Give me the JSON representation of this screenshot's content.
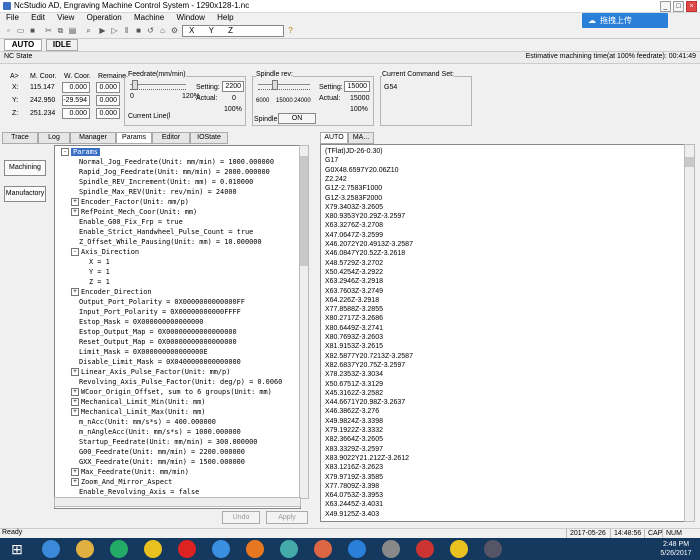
{
  "window": {
    "title": "NcStudio AD, Engraving Machine Control System - 1290x128-1.nc",
    "cloud_button": "拖拽上传"
  },
  "menu": [
    "File",
    "Edit",
    "View",
    "Operation",
    "Machine",
    "Window",
    "Help"
  ],
  "toolbar": {
    "coord_axes": [
      "X",
      "Y",
      "Z"
    ]
  },
  "mode": {
    "auto": "AUTO",
    "idle": "IDLE"
  },
  "nc_state": {
    "label": "NC State",
    "estimate": "Estimative machining time(at 100% feedrate): 00:41:49"
  },
  "coords": {
    "header_axis": "A>",
    "header_mcoor": "M. Coor.",
    "header_wcoor": "W. Coor.",
    "header_remain": "Remaine",
    "rows": [
      {
        "axis": "X:",
        "m": "115.147",
        "w": "0.000",
        "r": "0.000"
      },
      {
        "axis": "Y:",
        "m": "242.950",
        "w": "-29.594",
        "r": "0.000"
      },
      {
        "axis": "Z:",
        "m": "251.234",
        "w": "0.000",
        "r": "0.000"
      }
    ]
  },
  "feedrate": {
    "title": "Feedrate(mm/min)",
    "scale_left": "0",
    "scale_right": "120%",
    "setting_label": "Setting:",
    "setting_value": "2200",
    "actual_label": "Actual:",
    "actual_value": "0",
    "percent": "100%",
    "current_line": "Current Line(l"
  },
  "spindle": {
    "title": "Spindle rev:",
    "scale": [
      "6000",
      "15000",
      "24000"
    ],
    "setting_label": "Setting:",
    "setting_value": "15000",
    "actual_label": "Actual:",
    "actual_value": "15000",
    "percent": "100%",
    "spindle_label": "Spindle:",
    "spindle_state": "ON"
  },
  "command": {
    "title": "Current Command Set:",
    "value": "G54"
  },
  "left_tabs": [
    "Trace",
    "Log",
    "Manager",
    "Params",
    "Editor",
    "IOState"
  ],
  "right_tabs": [
    "AUTO",
    "MA..."
  ],
  "sidebar": {
    "machining": "Machining",
    "manufactory": "Manufactory"
  },
  "tree": [
    {
      "t": "Params",
      "l": 0,
      "e": "-",
      "root": true
    },
    {
      "t": "Normal_Jog_Feedrate(Unit: mm/min) = 1000.000000",
      "l": 1
    },
    {
      "t": "Rapid_Jog_Feedrate(Unit: mm/min) = 2000.000000",
      "l": 1
    },
    {
      "t": "Spindle_REV_Increment(Unit: mm) = 0.010000",
      "l": 1
    },
    {
      "t": "Spindle_Max_REV(Unit: rev/min) = 24000",
      "l": 1
    },
    {
      "t": "Encoder_Factor(Unit: mm/p)",
      "l": 1,
      "e": "+"
    },
    {
      "t": "RefPoint_Mech_Coor(Unit: mm)",
      "l": 1,
      "e": "+"
    },
    {
      "t": "Enable_G00_Fix_Frp = true",
      "l": 1
    },
    {
      "t": "Enable_Strict_Handwheel_Pulse_Count = true",
      "l": 1
    },
    {
      "t": "Z_Offset_While_Pausing(Unit: mm) = 10.000000",
      "l": 1
    },
    {
      "t": "Axis_Direction",
      "l": 1,
      "e": "-"
    },
    {
      "t": "X = 1",
      "l": 2
    },
    {
      "t": "Y = 1",
      "l": 2
    },
    {
      "t": "Z = 1",
      "l": 2
    },
    {
      "t": "Encoder_Direction",
      "l": 1,
      "e": "+"
    },
    {
      "t": "Output_Port_Polarity = 0X0000000000000FF",
      "l": 1
    },
    {
      "t": "Input_Port_Polarity = 0X00000000000FFFF",
      "l": 1
    },
    {
      "t": "Estop_Mask = 0X000000000000000",
      "l": 1
    },
    {
      "t": "Estop_Output_Map = 0X00000000000000000",
      "l": 1
    },
    {
      "t": "Reset_Output_Map = 0X00000000000000000",
      "l": 1
    },
    {
      "t": "Limit_Mask = 0X000000000000000E",
      "l": 1
    },
    {
      "t": "Disable_Limit_Mask = 0X0400000000000000",
      "l": 1
    },
    {
      "t": "Linear_Axis_Pulse_Factor(Unit: mm/p)",
      "l": 1,
      "e": "+"
    },
    {
      "t": "Revolving_Axis_Pulse_Factor(Unit: deg/p) = 0.0060",
      "l": 1
    },
    {
      "t": "WCoor_Origin_Offset, sum to 6 groups(Unit: mm)",
      "l": 1,
      "e": "+"
    },
    {
      "t": "Mechanical_Limit_Min(Unit: mm)",
      "l": 1,
      "e": "+"
    },
    {
      "t": "Mechanical_Limit_Max(Unit: mm)",
      "l": 1,
      "e": "+"
    },
    {
      "t": "m_nAcc(Unit: mm/s*s) = 400.000000",
      "l": 1
    },
    {
      "t": "m_nAngleAcc(Unit: mm/s*s) = 1000.000000",
      "l": 1
    },
    {
      "t": "Startup_Feedrate(Unit: mm/min) = 300.000000",
      "l": 1
    },
    {
      "t": "G00_Feedrate(Unit: mm/min) = 2200.000000",
      "l": 1
    },
    {
      "t": "GXX_Feedrate(Unit: mm/min) = 1500.000000",
      "l": 1
    },
    {
      "t": "Max_Feedrate(Unit: mm/min)",
      "l": 1,
      "e": "+"
    },
    {
      "t": "Zoom_And_Mirror_Aspect",
      "l": 1,
      "e": "+"
    },
    {
      "t": "Enable_Revolving_Axis = false",
      "l": 1
    }
  ],
  "gcode": [
    "(TFlat)JD-26-0.30)",
    "G17",
    "G0X48.6597Y20.06Z10",
    "Z2.242",
    "G1Z-2.7583F1000",
    "G1Z-3.2583F2000",
    "X79.3403Z-3.2605",
    "X80.9353Y20.29Z-3.2597",
    "X63.3276Z-3.2708",
    "X47.0647Z-3.2599",
    "X46.2072Y20.4913Z-3.2587",
    "X46.0847Y20.52Z-3.2618",
    "X48.5729Z-3.2702",
    "X50.4254Z-3.2922",
    "X63.2946Z-3.2918",
    "X63.7603Z-3.2749",
    "X64.226Z-3.2918",
    "X77.8588Z-3.2855",
    "X80.2717Z-3.2686",
    "X80.6449Z-3.2741",
    "X80.7693Z-3.2603",
    "X81.9153Z-3.2615",
    "X82.5877Y20.7213Z-3.2587",
    "X82.6837Y20.75Z-3.2597",
    "X78.2353Z-3.3034",
    "X50.6751Z-3.3129",
    "X45.3162Z-3.2582",
    "X44.6671Y20.98Z-3.2637",
    "X46.3862Z-3.276",
    "X49.9824Z-3.3398",
    "X79.1922Z-3.3332",
    "X82.3664Z-3.2605",
    "X83.3329Z-3.2597",
    "X83.9022Y21.212Z-3.2612",
    "X83.1216Z-3.2623",
    "X79.9719Z-3.3585",
    "X77.7809Z-3.398",
    "X64.0753Z-3.3953",
    "X63.2445Z-3.4031",
    "X49.9125Z-3.403"
  ],
  "buttons": {
    "undo": "Undo",
    "apply": "Apply"
  },
  "status": {
    "ready": "Ready",
    "date": "2017-05-26",
    "time": "14:48:56",
    "cap": "CAP",
    "num": "NUM"
  },
  "clock": {
    "time": "2:48 PM",
    "date": "5/26/2017"
  },
  "taskbar_icons": [
    "windows-start",
    "internet-explorer",
    "folder",
    "media-player",
    "chrome",
    "nc-studio",
    "baidu-cloud",
    "firefox",
    "paint",
    "app",
    "cloud-app",
    "hammer",
    "dp-app",
    "chrome-2",
    "tool-app"
  ],
  "colors": {
    "taskbar": "#15385e",
    "cloud": "#2a7fd8"
  }
}
